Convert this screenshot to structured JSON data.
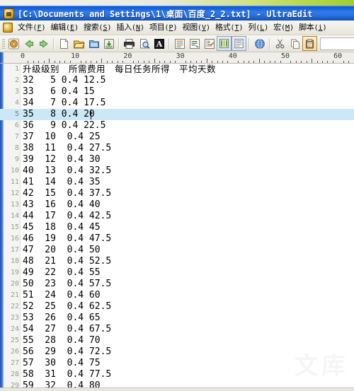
{
  "window": {
    "title": "[C:\\Documents and Settings\\1\\桌面\\百度_2_2.txt] - UltraEdit",
    "app_name": "UltraEdit",
    "icon": "ultraedit-app-icon"
  },
  "menubar": {
    "doc_icon": "document-icon",
    "items": [
      {
        "label": "文件",
        "key": "F"
      },
      {
        "label": "编辑",
        "key": "E"
      },
      {
        "label": "搜索",
        "key": "S"
      },
      {
        "label": "插入",
        "key": "N"
      },
      {
        "label": "项目",
        "key": "P"
      },
      {
        "label": "视图",
        "key": "V"
      },
      {
        "label": "格式",
        "key": "T"
      },
      {
        "label": "列",
        "key": "L"
      },
      {
        "label": "宏",
        "key": "M"
      },
      {
        "label": "脚本",
        "key": "i"
      }
    ]
  },
  "toolbar": {
    "buttons": [
      {
        "name": "ultraedit-logo-icon",
        "state": "normal"
      },
      {
        "name": "back-arrow-icon",
        "state": "normal"
      },
      {
        "name": "forward-arrow-icon",
        "state": "normal"
      },
      {
        "name": "new-file-icon",
        "state": "normal"
      },
      {
        "name": "open-file-icon",
        "state": "normal"
      },
      {
        "name": "open-folder-icon",
        "state": "normal"
      },
      {
        "name": "save-file-icon",
        "state": "normal"
      },
      {
        "name": "print-icon",
        "state": "normal"
      },
      {
        "name": "print-preview-icon",
        "state": "normal"
      },
      {
        "name": "font-icon",
        "state": "normal"
      },
      {
        "name": "word-wrap-icon",
        "state": "normal"
      },
      {
        "name": "line-numbers-icon",
        "state": "normal"
      },
      {
        "name": "hex-edit-icon",
        "state": "normal"
      },
      {
        "name": "column-mode-icon",
        "state": "active"
      },
      {
        "name": "template-icon",
        "state": "active"
      },
      {
        "name": "browser-preview-icon",
        "state": "normal"
      },
      {
        "name": "cut-icon",
        "state": "normal"
      },
      {
        "name": "copy-icon",
        "state": "normal"
      },
      {
        "name": "paste-icon",
        "state": "pressed"
      }
    ],
    "blank_field_value": ""
  },
  "ruler": {
    "labels": [
      "0",
      "10",
      "20",
      "30",
      "40",
      "50",
      "60"
    ]
  },
  "editor": {
    "current_line": 5,
    "caret_line": 5,
    "lines": [
      {
        "n": "1",
        "text": "升级级别　所需费用　每日任务所得　平均天数",
        "header": true
      },
      {
        "n": "2",
        "text": "32   5 0.4 12.5"
      },
      {
        "n": "3",
        "text": "33   6 0.4 15"
      },
      {
        "n": "4",
        "text": "34   7 0.4 17.5"
      },
      {
        "n": "5",
        "text": "35   8 0.4 20"
      },
      {
        "n": "6",
        "text": "36   9 0.4 22.5"
      },
      {
        "n": "7",
        "text": "37  10  0.4 25"
      },
      {
        "n": "8",
        "text": "38  11  0.4 27.5"
      },
      {
        "n": "9",
        "text": "39  12  0.4 30"
      },
      {
        "n": "10",
        "text": "40  13  0.4 32.5"
      },
      {
        "n": "11",
        "text": "41  14  0.4 35"
      },
      {
        "n": "12",
        "text": "42  15  0.4 37.5"
      },
      {
        "n": "13",
        "text": "43  16  0.4 40"
      },
      {
        "n": "14",
        "text": "44  17  0.4 42.5"
      },
      {
        "n": "15",
        "text": "45  18  0.4 45"
      },
      {
        "n": "16",
        "text": "46  19  0.4 47.5"
      },
      {
        "n": "17",
        "text": "47  20  0.4 50"
      },
      {
        "n": "18",
        "text": "48  21  0.4 52.5"
      },
      {
        "n": "19",
        "text": "49  22  0.4 55"
      },
      {
        "n": "20",
        "text": "50  23  0.4 57.5"
      },
      {
        "n": "21",
        "text": "51  24  0.4 60"
      },
      {
        "n": "22",
        "text": "52  25  0.4 62.5"
      },
      {
        "n": "23",
        "text": "53  26  0.4 65"
      },
      {
        "n": "24",
        "text": "54  27  0.4 67.5"
      },
      {
        "n": "25",
        "text": "55  28  0.4 70"
      },
      {
        "n": "26",
        "text": "56  29  0.4 72.5"
      },
      {
        "n": "27",
        "text": "57  30  0.4 75"
      },
      {
        "n": "28",
        "text": "58  31  0.4 77.5"
      },
      {
        "n": "29",
        "text": "59  32  0.4 80"
      }
    ]
  },
  "watermark": {
    "text": "文库"
  },
  "colors": {
    "titlebar_blue": "#2a72e2",
    "current_line_highlight": "#cce8f7",
    "gutter_bg": "#f4f4f2",
    "line_number": "#9a9a96",
    "editor_bg": "#ffffff",
    "toolbar_bg": "#f1f0ea"
  }
}
